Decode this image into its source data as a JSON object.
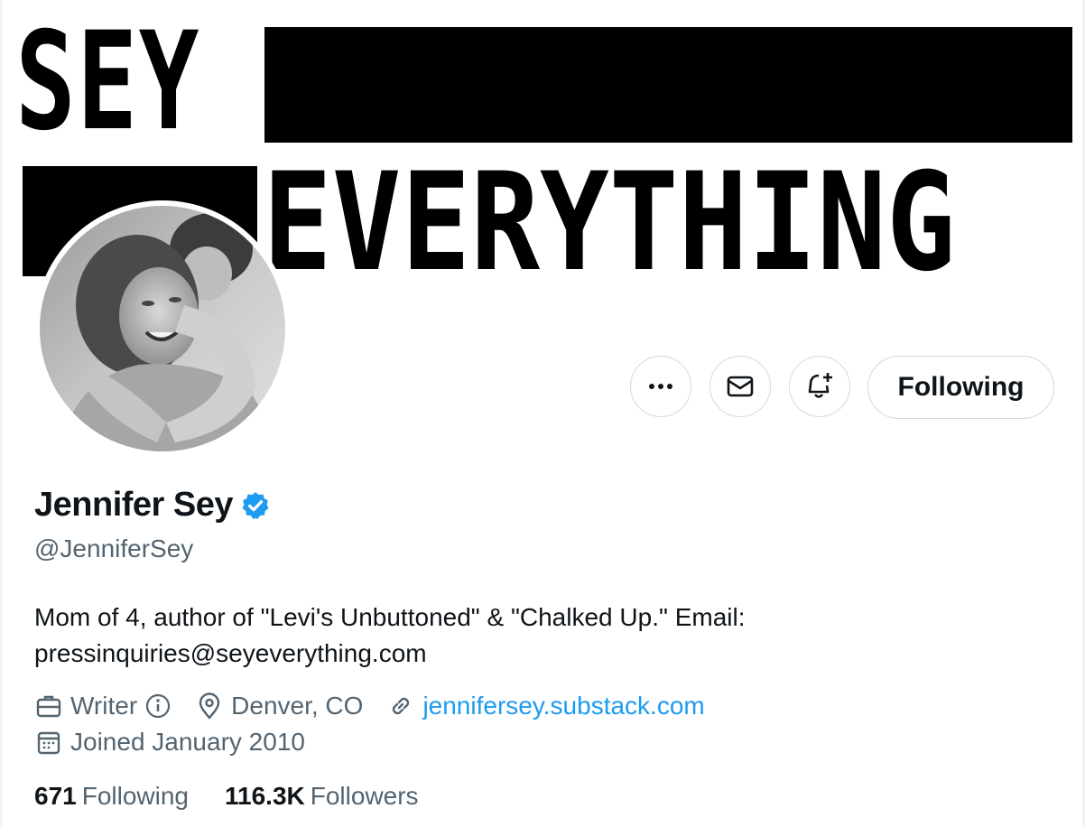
{
  "banner": {
    "line1": "SEY",
    "line2": "EVERYTHING"
  },
  "actions": {
    "more_icon": "more-icon",
    "message_icon": "envelope-icon",
    "notify_icon": "bell-plus-icon",
    "follow_label": "Following"
  },
  "profile": {
    "display_name": "Jennifer Sey",
    "verified": true,
    "handle": "@JenniferSey",
    "bio_line1": "Mom of 4, author of \"Levi's Unbuttoned\" & \"Chalked Up.\" Email:",
    "bio_line2": "pressinquiries@seyeverything.com",
    "category": "Writer",
    "location": "Denver, CO",
    "website": "jennifersey.substack.com",
    "joined": "Joined January 2010"
  },
  "stats": {
    "following_count": "671",
    "following_label": "Following",
    "followers_count": "116.3K",
    "followers_label": "Followers"
  },
  "colors": {
    "accent": "#1d9bf0",
    "text_primary": "#0f1419",
    "text_secondary": "#536471",
    "border": "#cfd9de"
  }
}
